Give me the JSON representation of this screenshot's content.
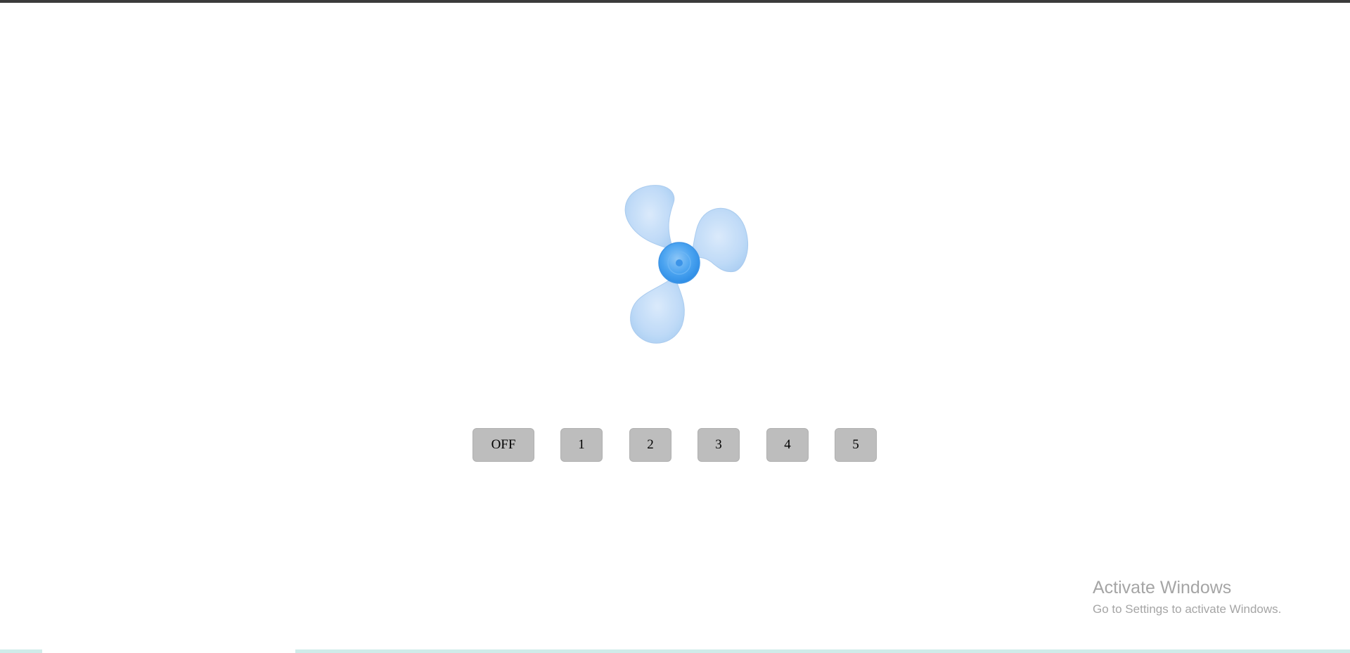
{
  "fan": {
    "icon": "fan-icon",
    "blade_color": "#b9d8f8",
    "hub_color": "#4aa3f0"
  },
  "controls": {
    "buttons": [
      {
        "label": "OFF"
      },
      {
        "label": "1"
      },
      {
        "label": "2"
      },
      {
        "label": "3"
      },
      {
        "label": "4"
      },
      {
        "label": "5"
      }
    ],
    "button_color": "#bdbdbd"
  },
  "watermark": {
    "title": "Activate Windows",
    "subtitle": "Go to Settings to activate Windows."
  }
}
